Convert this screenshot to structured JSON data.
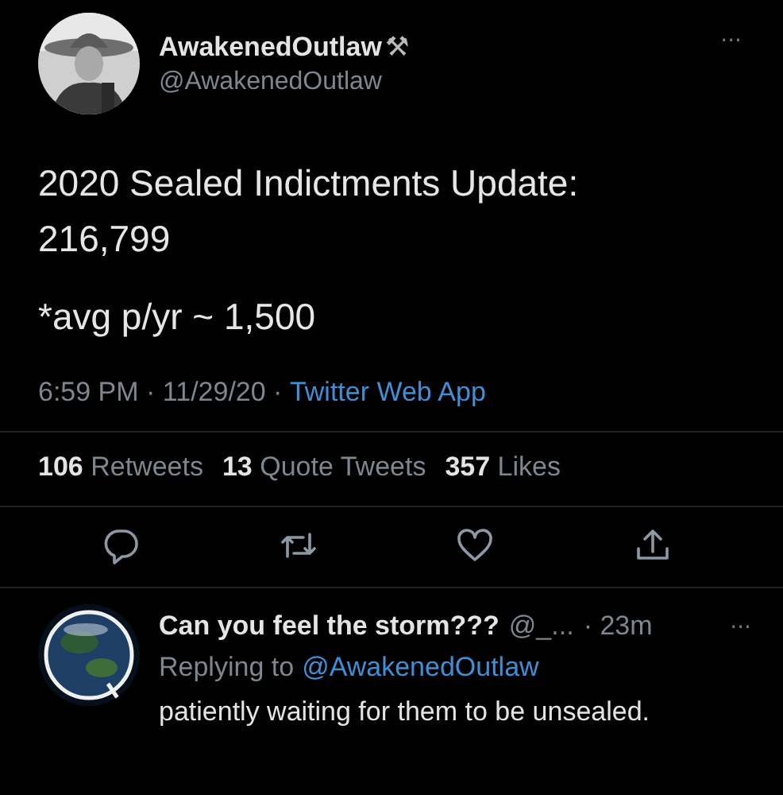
{
  "tweet": {
    "display_name": "AwakenedOutlaw",
    "name_emoji": "⚒",
    "handle": "@AwakenedOutlaw",
    "more": "···",
    "lines": [
      "2020 Sealed Indictments Update:",
      "216,799",
      "*avg p/yr ~ 1,500"
    ],
    "time": "6:59 PM · 11/29/20 · ",
    "source": "Twitter Web App",
    "stats": [
      {
        "count": "106",
        "label": "Retweets"
      },
      {
        "count": "13",
        "label": "Quote Tweets"
      },
      {
        "count": "357",
        "label": "Likes"
      }
    ],
    "actions": [
      {
        "kind": "reply"
      },
      {
        "kind": "retweet"
      },
      {
        "kind": "like"
      },
      {
        "kind": "share"
      }
    ]
  },
  "reply": {
    "display_name": "Can you feel the storm???",
    "handle": "@_...",
    "time": "· 23m",
    "more": "···",
    "replying_prefix": "Replying to",
    "replying_to": "@AwakenedOutlaw",
    "text": "patiently waiting for them to be unsealed."
  }
}
